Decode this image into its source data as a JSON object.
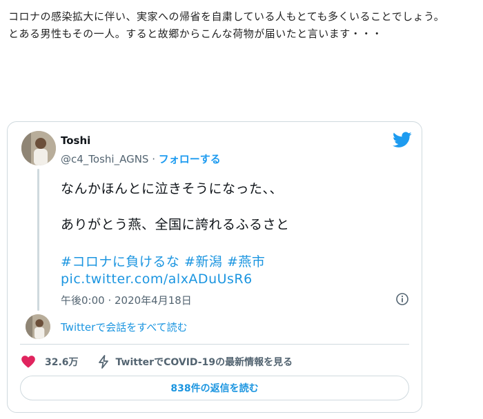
{
  "intro": {
    "line1": "コロナの感染拡大に伴い、実家への帰省を自粛している人もとても多くいることでしょう。",
    "line2": "とある男性もその一人。すると故郷からこんな荷物が届いたと言います・・・"
  },
  "tweet": {
    "author_name": "Toshi",
    "handle": "@c4_Toshi_AGNS",
    "separator": " · ",
    "follow_label": "フォローする",
    "text_line1": "なんかほんとに泣きそうになった、、",
    "text_line2": "ありがとう燕、全国に誇れるふるさと",
    "hashtags": [
      "#コロナに負けるな",
      "#新潟",
      "#燕市"
    ],
    "link": "pic.twitter.com/alxADuUsR6",
    "timestamp": "午後0:00 · 2020年4月18日",
    "read_conversation": "Twitterで会話をすべて読む",
    "like_count": "32.6万",
    "covid_info": "TwitterでCOVID-19の最新情報を見る",
    "replies_button": "838件の返信を読む"
  },
  "icons": {
    "bird": "twitter-bird-icon",
    "info": "info-icon",
    "heart": "heart-icon",
    "lightning": "lightning-icon"
  },
  "colors": {
    "link_blue": "#1b95e0",
    "twitter_blue": "#1d9bf0",
    "heart_pink": "#e0245e",
    "muted_gray": "#536471",
    "border": "#cfd9de"
  }
}
